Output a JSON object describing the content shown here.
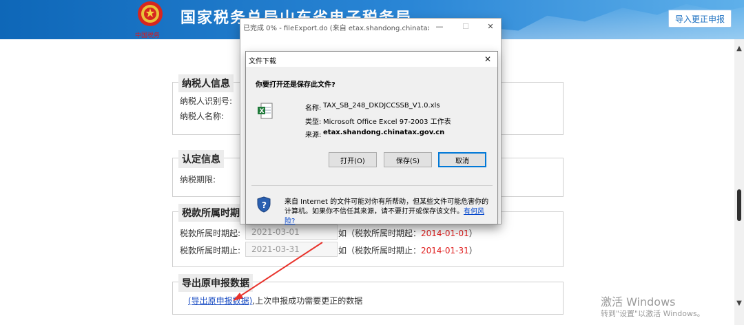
{
  "header": {
    "title": "国家税务总局山东省电子税务局",
    "emblem_caption": "中国税务",
    "import_button": "导入更正申报"
  },
  "taxpayer": {
    "legend": "纳税人信息",
    "id_label": "纳税人识别号:",
    "name_label": "纳税人名称:"
  },
  "identification": {
    "legend": "认定信息",
    "period_label": "纳税期限:"
  },
  "period": {
    "legend": "税款所属时期",
    "start_label": "税款所属时期起:",
    "start_value": "2021-03-01",
    "start_example_prefix": "如（税款所属时期起：",
    "start_example_date": "2014-01-01",
    "start_example_suffix": "）",
    "end_label": "税款所属时期止:",
    "end_value": "2021-03-31",
    "end_example_prefix": "如（税款所属时期止：",
    "end_example_date": "2014-01-31",
    "end_example_suffix": "）"
  },
  "export": {
    "legend": "导出原申报数据",
    "link_text": "(导出原申报数据)",
    "description": ",上次申报成功需要更正的数据"
  },
  "ie_window": {
    "title": "已完成 0% - fileExport.do (来自 etax.shandong.chinatax.g...",
    "minimize": "—",
    "maximize": "☐",
    "close": "✕"
  },
  "download_dialog": {
    "title": "文件下载",
    "close": "✕",
    "question": "你要打开还是保存此文件?",
    "name_label": "名称:",
    "name_value": "TAX_SB_248_DKDJCCSSB_V1.0.xls",
    "type_label": "类型:",
    "type_value": "Microsoft Office Excel 97-2003 工作表",
    "source_label": "来源:",
    "source_value": "etax.shandong.chinatax.gov.cn",
    "open_button": "打开(O)",
    "save_button": "保存(S)",
    "cancel_button": "取消",
    "warning": "来自 Internet 的文件可能对你有所帮助，但某些文件可能危害你的计算机。如果你不信任其来源，请不要打开或保存该文件。",
    "risk_link": "有何风险?"
  },
  "watermark": {
    "title": "激活 Windows",
    "subtitle": "转到\"设置\"以激活 Windows。"
  },
  "scrollbar": {
    "up": "▲",
    "down": "▼"
  },
  "colors": {
    "header_blue": "#0e67b8",
    "example_red": "#e02020",
    "link_blue": "#1d4fc4",
    "arrow_red": "#e8322b"
  }
}
